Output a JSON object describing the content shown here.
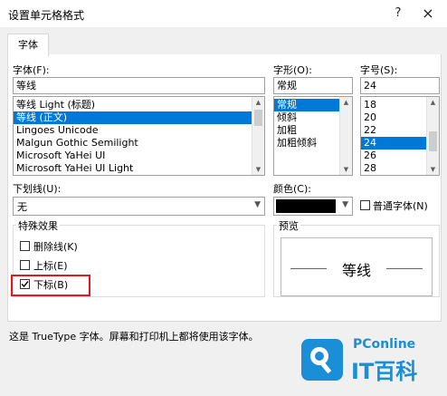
{
  "window": {
    "title": "设置单元格格式",
    "help_glyph": "?",
    "close_glyph": "×"
  },
  "tabs": [
    {
      "label": "字体",
      "selected": true
    }
  ],
  "font": {
    "label": "字体(F):",
    "value": "等线",
    "items": [
      {
        "label": "等线 Light (标题)",
        "selected": false
      },
      {
        "label": "等线 (正文)",
        "selected": true
      },
      {
        "label": "Lingoes Unicode",
        "selected": false
      },
      {
        "label": "Malgun Gothic Semilight",
        "selected": false
      },
      {
        "label": "Microsoft YaHei UI",
        "selected": false
      },
      {
        "label": "Microsoft YaHei UI Light",
        "selected": false
      }
    ]
  },
  "style": {
    "label": "字形(O):",
    "value": "常规",
    "items": [
      {
        "label": "常规",
        "selected": true
      },
      {
        "label": "倾斜",
        "selected": false
      },
      {
        "label": "加粗",
        "selected": false
      },
      {
        "label": "加粗倾斜",
        "selected": false
      }
    ]
  },
  "size": {
    "label": "字号(S):",
    "value": "24",
    "items": [
      {
        "label": "18",
        "selected": false
      },
      {
        "label": "20",
        "selected": false
      },
      {
        "label": "22",
        "selected": false
      },
      {
        "label": "24",
        "selected": true
      },
      {
        "label": "26",
        "selected": false
      },
      {
        "label": "28",
        "selected": false
      }
    ]
  },
  "underline": {
    "label": "下划线(U):",
    "value": "无"
  },
  "color": {
    "label": "颜色(C):",
    "swatch": "#000000",
    "normal_font_label": "普通字体(N)",
    "normal_font_checked": false
  },
  "effects": {
    "group_label": "特殊效果",
    "strikethrough": {
      "label": "删除线(K)",
      "checked": false
    },
    "superscript": {
      "label": "上标(E)",
      "checked": false
    },
    "subscript": {
      "label": "下标(B)",
      "checked": true
    }
  },
  "preview": {
    "group_label": "预览",
    "sample_text": "等线"
  },
  "footer_note": "这是 TrueType 字体。屏幕和打印机上都将使用该字体。",
  "watermark": {
    "brand": "PConline",
    "cn_text": "IT百科",
    "accent": "#1a8fd8",
    "highlight": "#e0191f"
  }
}
